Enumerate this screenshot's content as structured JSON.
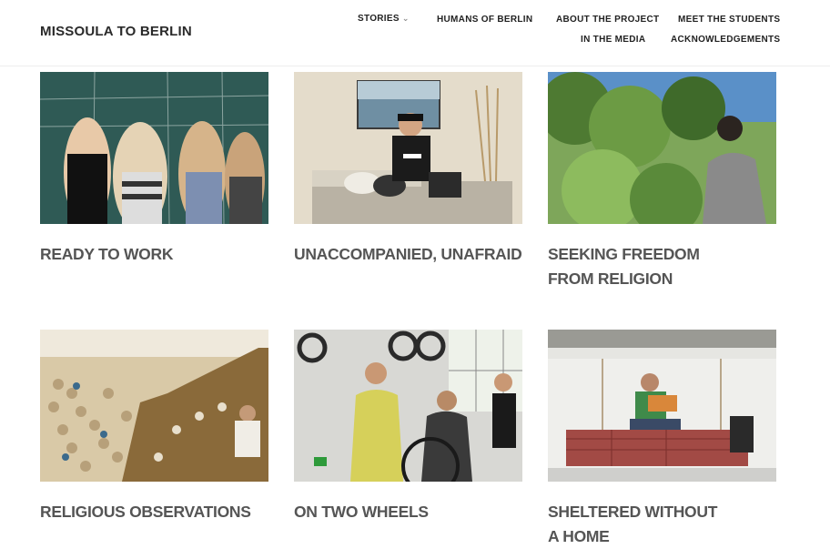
{
  "site": {
    "title": "MISSOULA TO BERLIN"
  },
  "nav": {
    "stories": "STORIES",
    "humans": "HUMANS OF BERLIN",
    "about": "ABOUT THE PROJECT",
    "students": "MEET THE STUDENTS",
    "media": "IN THE MEDIA",
    "acknowledgements": "ACKNOWLEDGEMENTS"
  },
  "stories": [
    {
      "title": "READY TO WORK",
      "image": "classroom-chalkboard-photo"
    },
    {
      "title": "UNACCOMPANIED, UNAFRAID",
      "image": "young-man-on-couch-photo"
    },
    {
      "title": "SEEKING FREEDOM FROM RELIGION",
      "image": "man-in-garden-photo"
    },
    {
      "title": "RELIGIOUS OBSERVATIONS",
      "image": "mosque-prayer-photo"
    },
    {
      "title": "ON TWO WHEELS",
      "image": "bike-workshop-photo"
    },
    {
      "title": "SHELTERED WITHOUT A HOME",
      "image": "reading-on-cot-photo"
    }
  ],
  "colors": {
    "heading": "#555555",
    "nav": "#222222",
    "nav_muted": "#8a8a8a"
  }
}
